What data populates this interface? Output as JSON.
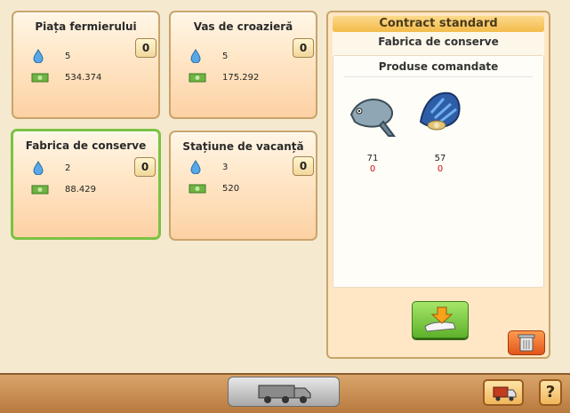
{
  "cards": [
    {
      "title": "Piața fermierului",
      "water": "5",
      "money": "534.374",
      "badge": "0"
    },
    {
      "title": "Vas de croazieră",
      "water": "5",
      "money": "175.292",
      "badge": "0"
    },
    {
      "title": "Fabrica de conserve",
      "water": "2",
      "money": "88.429",
      "badge": "0"
    },
    {
      "title": "Stațiune de vacanță",
      "water": "3",
      "money": "520",
      "badge": "0"
    }
  ],
  "contract": {
    "header": "Contract standard",
    "subtitle": "Fabrica de conserve",
    "products_title": "Produse comandate",
    "products": [
      {
        "icon": "fish-icon",
        "quantity": "71",
        "remaining": "0"
      },
      {
        "icon": "shell-icon",
        "quantity": "57",
        "remaining": "0"
      }
    ]
  },
  "footer": {
    "truck_label": "",
    "help_label": "?"
  },
  "colors": {
    "card_border_selected": "#7cc243",
    "panel_header": "#f3bb4a",
    "remaining_red": "#d01010"
  }
}
